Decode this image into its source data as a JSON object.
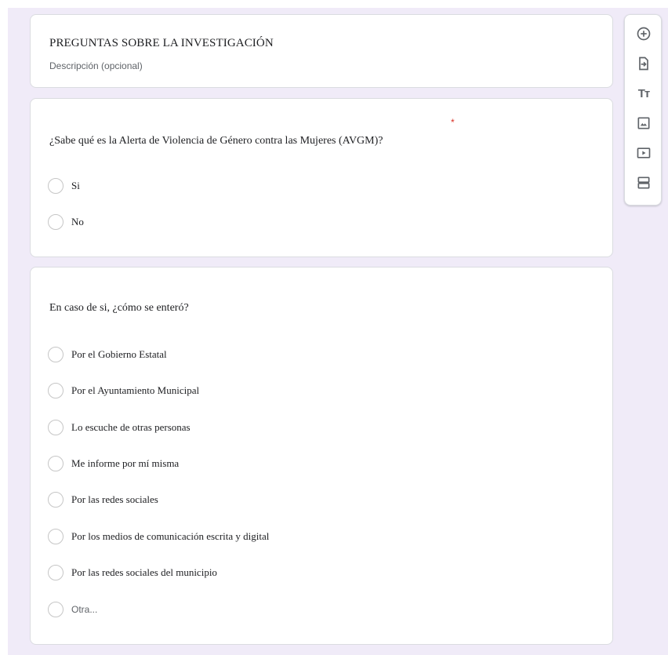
{
  "section": {
    "title": "PREGUNTAS SOBRE LA INVESTIGACIÓN",
    "description": "Descripción (opcional)"
  },
  "question1": {
    "title": "¿Sabe qué es la Alerta de Violencia de Género contra las Mujeres (AVGM)?",
    "required_mark": "*",
    "options": [
      "Si",
      "No"
    ]
  },
  "question2": {
    "title": "En caso de si, ¿cómo se enteró?",
    "options": [
      "Por el Gobierno Estatal",
      "Por el Ayuntamiento Municipal",
      "Lo escuche de otras personas",
      "Me informe por mí misma",
      "Por las redes sociales",
      "Por los medios de comunicación escrita y digital",
      "Por las redes sociales del municipio"
    ],
    "other_label": "Otra..."
  },
  "toolbar": {
    "title_text_glyph": "Tт",
    "icons": [
      "add-question-icon",
      "import-questions-icon",
      "add-title-icon",
      "add-image-icon",
      "add-video-icon",
      "add-section-icon"
    ]
  },
  "colors": {
    "background": "#f0ebf8",
    "required": "#d93025",
    "border": "#dadce0"
  }
}
